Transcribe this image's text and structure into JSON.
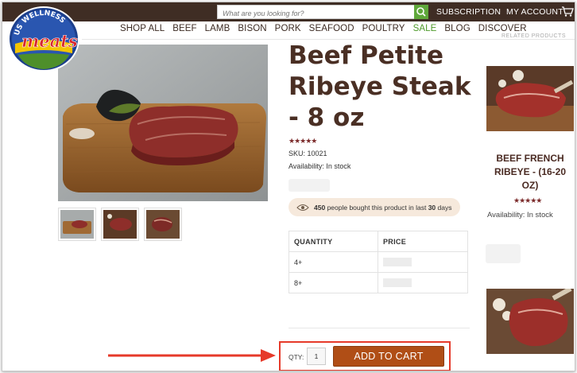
{
  "header": {
    "search_placeholder": "What are you looking for?",
    "subscription": "SUBSCRIPTION",
    "my_account": "MY ACCOUNT",
    "logo_text_top": "US WELLNESS",
    "logo_text_main": "meats"
  },
  "nav": {
    "items": [
      "SHOP ALL",
      "BEEF",
      "LAMB",
      "BISON",
      "PORK",
      "SEAFOOD",
      "POULTRY",
      "SALE",
      "BLOG",
      "DISCOVER"
    ],
    "sale_color": "#4e9a2a"
  },
  "product": {
    "title": "Beef Petite Ribeye Steak - 8 oz",
    "rating_stars": "★★★★★",
    "sku": "SKU: 10021",
    "availability": "Availability: In stock",
    "bought_count": "450",
    "bought_text_mid": "people bought this product in last",
    "bought_days": "30",
    "bought_text_end": "days"
  },
  "price_table": {
    "headers": [
      "QUANTITY",
      "PRICE"
    ],
    "rows": [
      {
        "quantity": "4+"
      },
      {
        "quantity": "8+"
      }
    ]
  },
  "cart": {
    "qty_label": "QTY:",
    "qty_value": "1",
    "add_to_cart": "ADD TO CART",
    "highlight_color": "#e63a2a",
    "button_color": "#b04e16"
  },
  "sidebar": {
    "heading": "RELATED PRODUCTS",
    "related_title": "BEEF FRENCH RIBEYE - (16-20 OZ)",
    "related_stars": "★★★★★",
    "related_availability": "Availability: In stock"
  },
  "colors": {
    "topbar": "#3f2d24",
    "title": "#4a2f24",
    "search_button": "#5fa83a"
  }
}
